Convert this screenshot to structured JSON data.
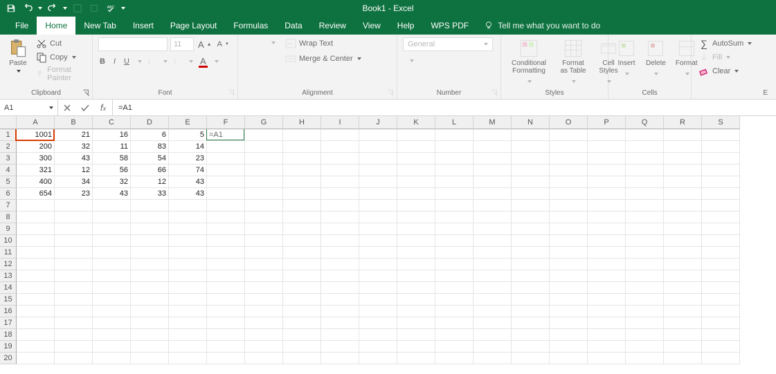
{
  "title": "Book1 - Excel",
  "qat": {
    "save": "save",
    "undo": "undo",
    "redo": "redo"
  },
  "tabs": {
    "file": "File",
    "home": "Home",
    "newtab": "New Tab",
    "insert": "Insert",
    "pagelayout": "Page Layout",
    "formulas": "Formulas",
    "data": "Data",
    "review": "Review",
    "view": "View",
    "help": "Help",
    "wpspdf": "WPS PDF",
    "tellme": "Tell me what you want to do"
  },
  "ribbon": {
    "clipboard": {
      "label": "Clipboard",
      "paste": "Paste",
      "cut": "Cut",
      "copy": "Copy",
      "formatpainter": "Format Painter"
    },
    "font": {
      "label": "Font",
      "size": "11",
      "bold": "B",
      "italic": "I",
      "underline": "U"
    },
    "alignment": {
      "label": "Alignment",
      "wrap": "Wrap Text",
      "merge": "Merge & Center"
    },
    "number": {
      "label": "Number",
      "format": "General"
    },
    "styles": {
      "label": "Styles",
      "cond": "Conditional Formatting",
      "table": "Format as Table",
      "cell": "Cell Styles"
    },
    "cells": {
      "label": "Cells",
      "insert": "Insert",
      "delete": "Delete",
      "format": "Format"
    },
    "editing": {
      "label": "E",
      "autosum": "AutoSum",
      "fill": "Fill",
      "clear": "Clear"
    }
  },
  "fbar": {
    "name": "A1",
    "formula": "=A1"
  },
  "columns": [
    "A",
    "B",
    "C",
    "D",
    "E",
    "F",
    "G",
    "H",
    "I",
    "J",
    "K",
    "L",
    "M",
    "N",
    "O",
    "P",
    "Q",
    "R",
    "S"
  ],
  "rows": 20,
  "data": [
    [
      "1001",
      "21",
      "16",
      "6",
      "5",
      "=A1"
    ],
    [
      "200",
      "32",
      "11",
      "83",
      "14",
      ""
    ],
    [
      "300",
      "43",
      "58",
      "54",
      "23",
      ""
    ],
    [
      "321",
      "12",
      "56",
      "66",
      "74",
      ""
    ],
    [
      "400",
      "34",
      "32",
      "12",
      "43",
      ""
    ],
    [
      "654",
      "23",
      "43",
      "33",
      "43",
      ""
    ]
  ],
  "active": {
    "row": 0,
    "col": 5
  },
  "marquee": {
    "row": 0,
    "col": 0
  },
  "red_highlight": {
    "row": 0,
    "col": 0
  }
}
